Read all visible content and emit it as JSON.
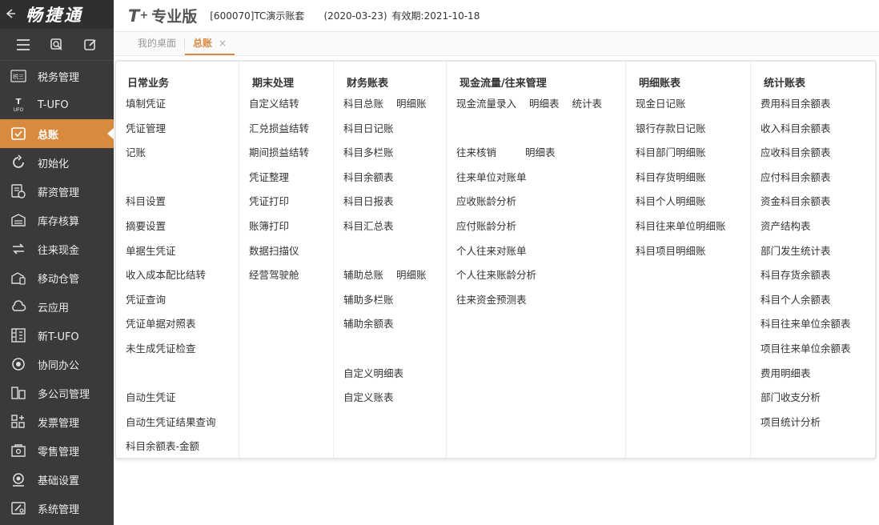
{
  "app": {
    "brand": "畅捷通",
    "product_t": "T",
    "product_plus": "+",
    "product_name": "专业版",
    "account": "[600070]TC演示账套",
    "date": "(2020-03-23)",
    "validity": "有效期:2021-10-18"
  },
  "sidebar": {
    "items": [
      {
        "label": "税务管理",
        "icon": "tax-icon"
      },
      {
        "label": "T-UFO",
        "icon": "ufo-icon"
      },
      {
        "label": "总账",
        "icon": "ledger-icon",
        "active": true
      },
      {
        "label": "初始化",
        "icon": "init-icon"
      },
      {
        "label": "薪资管理",
        "icon": "salary-icon"
      },
      {
        "label": "库存核算",
        "icon": "warehouse-icon"
      },
      {
        "label": "往来现金",
        "icon": "cash-flow-icon"
      },
      {
        "label": "移动仓管",
        "icon": "mobile-warehouse-icon"
      },
      {
        "label": "云应用",
        "icon": "cloud-icon"
      },
      {
        "label": "新T-UFO",
        "icon": "new-ufo-icon"
      },
      {
        "label": "协同办公",
        "icon": "collab-icon"
      },
      {
        "label": "多公司管理",
        "icon": "multi-company-icon"
      },
      {
        "label": "发票管理",
        "icon": "invoice-icon"
      },
      {
        "label": "零售管理",
        "icon": "retail-icon"
      },
      {
        "label": "基础设置",
        "icon": "settings-icon"
      },
      {
        "label": "系统管理",
        "icon": "system-icon"
      }
    ]
  },
  "tabs": [
    {
      "label": "我的桌面"
    },
    {
      "label": "总账",
      "active": true,
      "close": "×"
    }
  ],
  "menu": {
    "columns": [
      {
        "title": "日常业务",
        "rows": [
          [
            "填制凭证"
          ],
          [
            "凭证管理"
          ],
          [
            "记账"
          ],
          [],
          [
            "科目设置"
          ],
          [
            "摘要设置"
          ],
          [
            "单据生凭证"
          ],
          [
            "收入成本配比结转"
          ],
          [
            "凭证查询"
          ],
          [
            "凭证单据对照表"
          ],
          [
            "未生成凭证检查"
          ],
          [],
          [
            "自动生凭证"
          ],
          [
            "自动生凭证结果查询"
          ],
          [
            "科目余额表-金额"
          ]
        ]
      },
      {
        "title": "期末处理",
        "rows": [
          [
            "自定义结转"
          ],
          [
            "汇兑损益结转"
          ],
          [
            "期间损益结转"
          ],
          [
            "凭证整理"
          ],
          [
            "凭证打印"
          ],
          [
            "账簿打印"
          ],
          [
            "数据扫描仪"
          ],
          [
            "经营驾驶舱"
          ]
        ]
      },
      {
        "title": "财务账表",
        "rows": [
          [
            "科目总账",
            "明细账"
          ],
          [
            "科目日记账"
          ],
          [
            "科目多栏账"
          ],
          [
            "科目余额表"
          ],
          [
            "科目日报表"
          ],
          [
            "科目汇总表"
          ],
          [],
          [
            "辅助总账",
            "明细账"
          ],
          [
            "辅助多栏账"
          ],
          [
            "辅助余额表"
          ],
          [],
          [
            "自定义明细表"
          ],
          [
            "自定义账表"
          ]
        ]
      },
      {
        "title": "现金流量/往来管理",
        "rows": [
          [
            "现金流量录入",
            "明细表",
            "统计表"
          ],
          [],
          [
            "往来核销",
            "明细表"
          ],
          [
            "往来单位对账单"
          ],
          [
            "应收账龄分析"
          ],
          [
            "应付账龄分析"
          ],
          [
            "个人往来对账单"
          ],
          [
            "个人往来账龄分析"
          ],
          [
            "往来资金预测表"
          ]
        ]
      },
      {
        "title": "明细账表",
        "rows": [
          [
            "现金日记账"
          ],
          [
            "银行存款日记账"
          ],
          [
            "科目部门明细账"
          ],
          [
            "科目存货明细账"
          ],
          [
            "科目个人明细账"
          ],
          [
            "科目往来单位明细账"
          ],
          [
            "科目项目明细账"
          ]
        ]
      },
      {
        "title": "统计账表",
        "rows": [
          [
            "费用科目余额表"
          ],
          [
            "收入科目余额表"
          ],
          [
            "应收科目余额表"
          ],
          [
            "应付科目余额表"
          ],
          [
            "资金科目余额表"
          ],
          [
            "资产结构表"
          ],
          [
            "部门发生统计表"
          ],
          [
            "科目存货余额表"
          ],
          [
            "科目个人余额表"
          ],
          [
            "科目往来单位余额表"
          ],
          [
            "项目往来单位余额表"
          ],
          [
            "费用明细表"
          ],
          [
            "部门收支分析"
          ],
          [
            "项目统计分析"
          ]
        ]
      }
    ]
  }
}
